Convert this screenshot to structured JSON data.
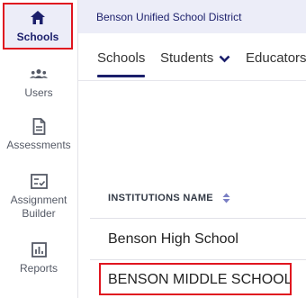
{
  "sidebar": {
    "items": [
      {
        "label": "Schools",
        "icon": "home-icon"
      },
      {
        "label": "Users",
        "icon": "users-icon"
      },
      {
        "label": "Assessments",
        "icon": "document-icon"
      },
      {
        "label": "Assignment Builder",
        "icon": "checklist-icon"
      },
      {
        "label": "Reports",
        "icon": "bar-chart-icon"
      }
    ]
  },
  "header": {
    "district": "Benson Unified School District"
  },
  "tabs": [
    {
      "label": "Schools"
    },
    {
      "label": "Students"
    },
    {
      "label": "Educators"
    }
  ],
  "table": {
    "column_header": "INSTITUTIONS NAME",
    "rows": [
      {
        "name": "Benson High School"
      },
      {
        "name": "BENSON MIDDLE SCHOOL"
      }
    ]
  },
  "colors": {
    "accent": "#1b1f6b",
    "highlight": "#e0151f",
    "active_bg": "#ecedf8"
  }
}
